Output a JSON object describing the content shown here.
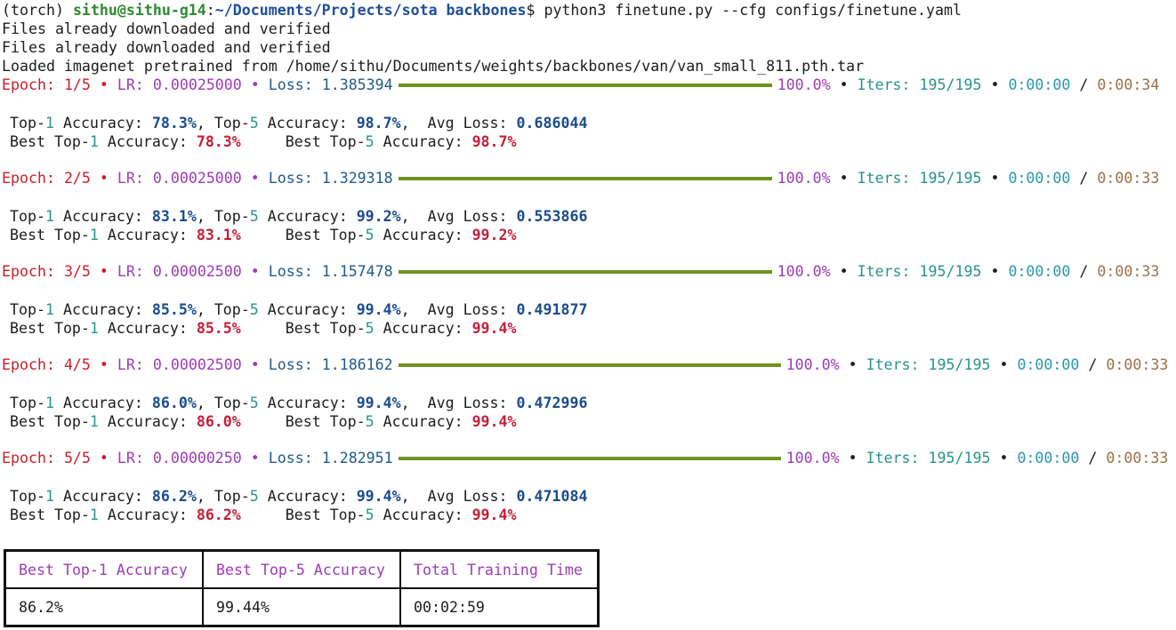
{
  "prompt": {
    "env": "(torch) ",
    "user_host": "sithu@sithu-g14",
    "colon": ":",
    "path": "~/Documents/Projects/sota backbones",
    "dollar": "$ ",
    "command": "python3 finetune.py --cfg configs/finetune.yaml"
  },
  "preamble": [
    "Files already downloaded and verified",
    "Files already downloaded and verified",
    "Loaded imagenet pretrained from /home/sithu/Documents/weights/backbones/van/van_small_811.pth.tar"
  ],
  "labels": {
    "epoch": "Epoch: ",
    "bullet": " • ",
    "lr": "LR: ",
    "loss": "Loss: ",
    "iters": "Iters: ",
    "slash": " / ",
    "top": "Top-",
    "one": "1",
    "five": "5",
    "accuracy": " Accuracy: ",
    "comma_sep": ", ",
    "avg_loss": ",  Avg Loss: ",
    "best_top": "Best Top-",
    "best_gap": "     "
  },
  "epochs": [
    {
      "epoch": "1/5",
      "lr": "0.00025000",
      "loss": "1.385394",
      "progress": "100.0%",
      "iters": "195/195",
      "elapsed": "0:00:00",
      "remaining": "0:00:34",
      "top1": "78.3%",
      "top5": "98.7%",
      "avg_loss": "0.686044",
      "best_top1": "78.3%",
      "best_top5": "98.7%"
    },
    {
      "epoch": "2/5",
      "lr": "0.00025000",
      "loss": "1.329318",
      "progress": "100.0%",
      "iters": "195/195",
      "elapsed": "0:00:00",
      "remaining": "0:00:33",
      "top1": "83.1%",
      "top5": "99.2%",
      "avg_loss": "0.553866",
      "best_top1": "83.1%",
      "best_top5": "99.2%"
    },
    {
      "epoch": "3/5",
      "lr": "0.00002500",
      "loss": "1.157478",
      "progress": "100.0%",
      "iters": "195/195",
      "elapsed": "0:00:00",
      "remaining": "0:00:33",
      "top1": "85.5%",
      "top5": "99.4%",
      "avg_loss": "0.491877",
      "best_top1": "85.5%",
      "best_top5": "99.4%"
    },
    {
      "epoch": "4/5",
      "lr": "0.00002500",
      "loss": "1.186162",
      "progress": "100.0%",
      "iters": "195/195",
      "elapsed": "0:00:00",
      "remaining": "0:00:33",
      "top1": "86.0%",
      "top5": "99.4%",
      "avg_loss": "0.472996",
      "best_top1": "86.0%",
      "best_top5": "99.4%"
    },
    {
      "epoch": "5/5",
      "lr": "0.00000250",
      "loss": "1.282951",
      "progress": "100.0%",
      "iters": "195/195",
      "elapsed": "0:00:00",
      "remaining": "0:00:33",
      "top1": "86.2%",
      "top5": "99.4%",
      "avg_loss": "0.471084",
      "best_top1": "86.2%",
      "best_top5": "99.4%"
    }
  ],
  "summary": {
    "headers": [
      "Best Top-1 Accuracy",
      "Best Top-5 Accuracy",
      "Total Training Time"
    ],
    "values": [
      "86.2%",
      "99.44%",
      "00:02:59"
    ]
  },
  "colors": {
    "progress_bar": "#6f9321",
    "prompt_user": "#2e8b2e",
    "prompt_path": "#1f4f9a",
    "epoch": "#c3203a",
    "lr": "#9d3cb5",
    "loss": "#1f4f9a",
    "percent": "#9d3cb5",
    "iters": "#28948c",
    "elapsed": "#2a96ae",
    "remaining": "#9a7147",
    "table_header": "#9d3cb5"
  }
}
